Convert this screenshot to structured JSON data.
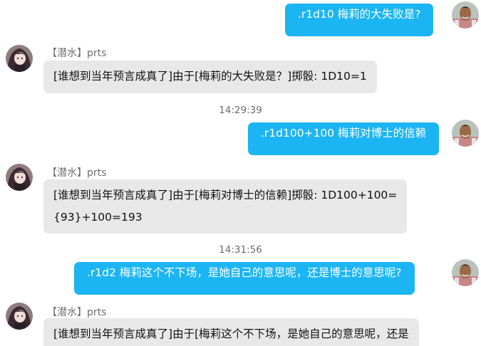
{
  "colors": {
    "self_bubble": "#1cb5f3",
    "other_bubble": "#e8e8e9",
    "nick_text": "#6e6e6e",
    "timestamp_text": "#6b6b6b"
  },
  "messages": [
    {
      "kind": "self",
      "text": ".r1d10 梅莉的大失败是?",
      "avatar_icon": "user-avatar-icon"
    },
    {
      "kind": "other",
      "title": "【潜水】",
      "name": "prts",
      "text": "[谁想到当年预言成真了]由于[梅莉的大失败是？]掷骰: 1D10=1",
      "avatar_icon": "bot-avatar-icon"
    },
    {
      "kind": "time",
      "text": "14:29:39"
    },
    {
      "kind": "self",
      "text": ".r1d100+100 梅莉对博士的信赖",
      "avatar_icon": "user-avatar-icon"
    },
    {
      "kind": "other",
      "title": "【潜水】",
      "name": "prts",
      "text_lines": [
        "[谁想到当年预言成真了]由于[梅莉对博士的信赖]掷骰: 1D100+100=",
        "{93}+100=193"
      ],
      "avatar_icon": "bot-avatar-icon"
    },
    {
      "kind": "time",
      "text": "14:31:56"
    },
    {
      "kind": "self",
      "text": ".r1d2 梅莉这个不下场，是她自己的意思呢，还是博士的意思呢?",
      "avatar_icon": "user-avatar-icon"
    },
    {
      "kind": "other",
      "title": "【潜水】",
      "name": "prts",
      "text": "[谁想到当年预言成真了]由于[梅莉这个不下场，是她自己的意思呢，还是",
      "avatar_icon": "bot-avatar-icon"
    }
  ]
}
